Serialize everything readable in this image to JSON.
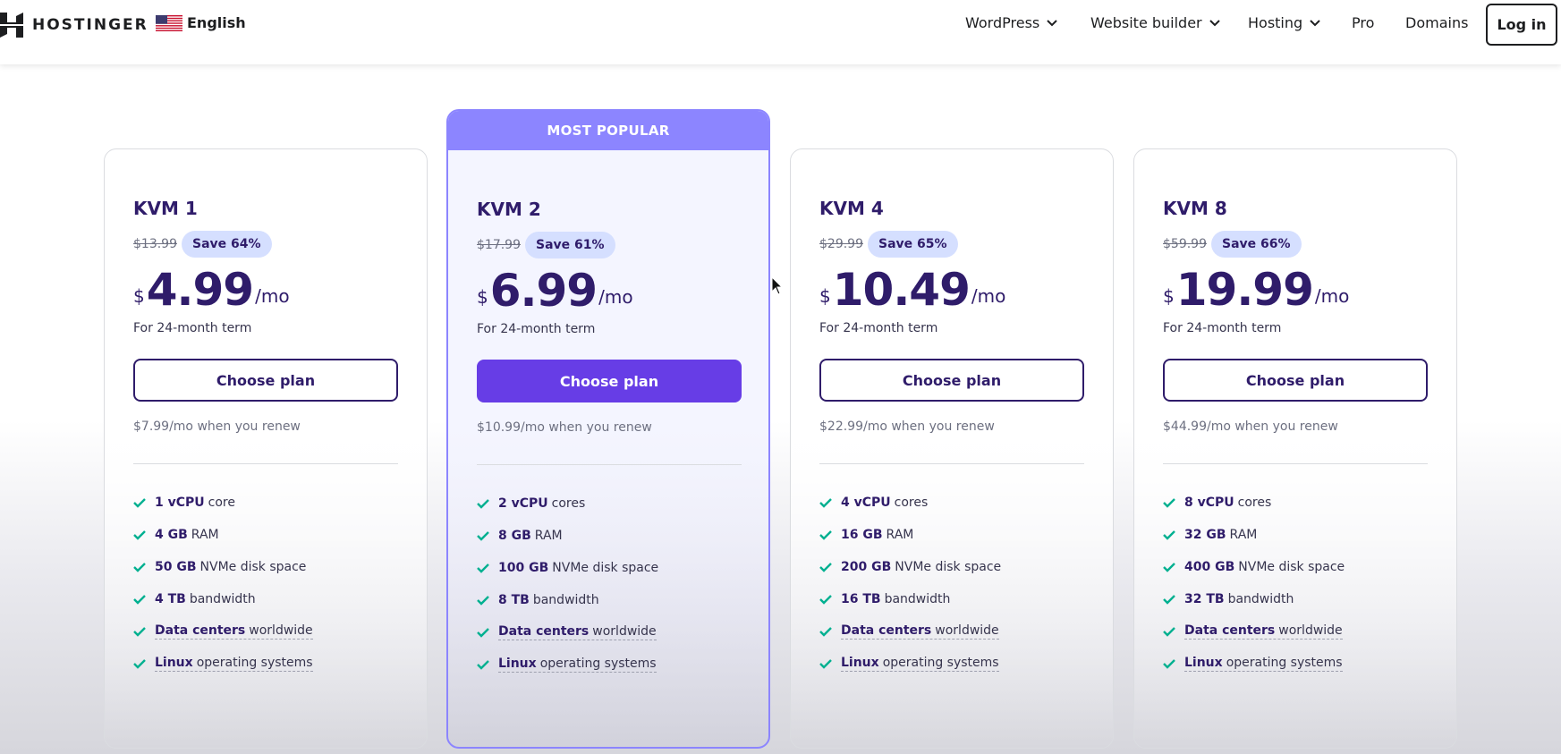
{
  "header": {
    "logo_text": "HOSTINGER",
    "language": "English",
    "nav": [
      {
        "label": "WordPress",
        "dropdown": true
      },
      {
        "label": "Website builder",
        "dropdown": true
      },
      {
        "label": "Hosting",
        "dropdown": true
      },
      {
        "label": "Pro",
        "dropdown": false
      },
      {
        "label": "Domains",
        "dropdown": false
      }
    ],
    "login_label": "Log in"
  },
  "colors": {
    "brand_purple": "#673de6",
    "popular_badge": "#8c85ff",
    "save_badge_bg": "#d5dfff",
    "check_green": "#00b090",
    "heading": "#2f1c6a"
  },
  "popular_label": "MOST POPULAR",
  "plans": [
    {
      "name": "KVM 1",
      "old_price": "$13.99",
      "save": "Save 64%",
      "currency": "$",
      "price": "4.99",
      "per": "/mo",
      "term": "For 24-month term",
      "cta": "Choose plan",
      "renew": "$7.99/mo when you renew",
      "features": [
        {
          "bold": "1 vCPU",
          "rest": "core"
        },
        {
          "bold": "4 GB",
          "rest": "RAM"
        },
        {
          "bold": "50 GB",
          "rest": "NVMe disk space"
        },
        {
          "bold": "4 TB",
          "rest": "bandwidth"
        },
        {
          "bold": "Data centers",
          "rest": "worldwide"
        },
        {
          "bold": "Linux",
          "rest": "operating systems"
        }
      ]
    },
    {
      "name": "KVM 2",
      "old_price": "$17.99",
      "save": "Save 61%",
      "currency": "$",
      "price": "6.99",
      "per": "/mo",
      "term": "For 24-month term",
      "cta": "Choose plan",
      "renew": "$10.99/mo when you renew",
      "features": [
        {
          "bold": "2 vCPU",
          "rest": "cores"
        },
        {
          "bold": "8 GB",
          "rest": "RAM"
        },
        {
          "bold": "100 GB",
          "rest": "NVMe disk space"
        },
        {
          "bold": "8 TB",
          "rest": "bandwidth"
        },
        {
          "bold": "Data centers",
          "rest": "worldwide"
        },
        {
          "bold": "Linux",
          "rest": "operating systems"
        }
      ]
    },
    {
      "name": "KVM 4",
      "old_price": "$29.99",
      "save": "Save 65%",
      "currency": "$",
      "price": "10.49",
      "per": "/mo",
      "term": "For 24-month term",
      "cta": "Choose plan",
      "renew": "$22.99/mo when you renew",
      "features": [
        {
          "bold": "4 vCPU",
          "rest": "cores"
        },
        {
          "bold": "16 GB",
          "rest": "RAM"
        },
        {
          "bold": "200 GB",
          "rest": "NVMe disk space"
        },
        {
          "bold": "16 TB",
          "rest": "bandwidth"
        },
        {
          "bold": "Data centers",
          "rest": "worldwide"
        },
        {
          "bold": "Linux",
          "rest": "operating systems"
        }
      ]
    },
    {
      "name": "KVM 8",
      "old_price": "$59.99",
      "save": "Save 66%",
      "currency": "$",
      "price": "19.99",
      "per": "/mo",
      "term": "For 24-month term",
      "cta": "Choose plan",
      "renew": "$44.99/mo when you renew",
      "features": [
        {
          "bold": "8 vCPU",
          "rest": "cores"
        },
        {
          "bold": "32 GB",
          "rest": "RAM"
        },
        {
          "bold": "400 GB",
          "rest": "NVMe disk space"
        },
        {
          "bold": "32 TB",
          "rest": "bandwidth"
        },
        {
          "bold": "Data centers",
          "rest": "worldwide"
        },
        {
          "bold": "Linux",
          "rest": "operating systems"
        }
      ]
    }
  ]
}
